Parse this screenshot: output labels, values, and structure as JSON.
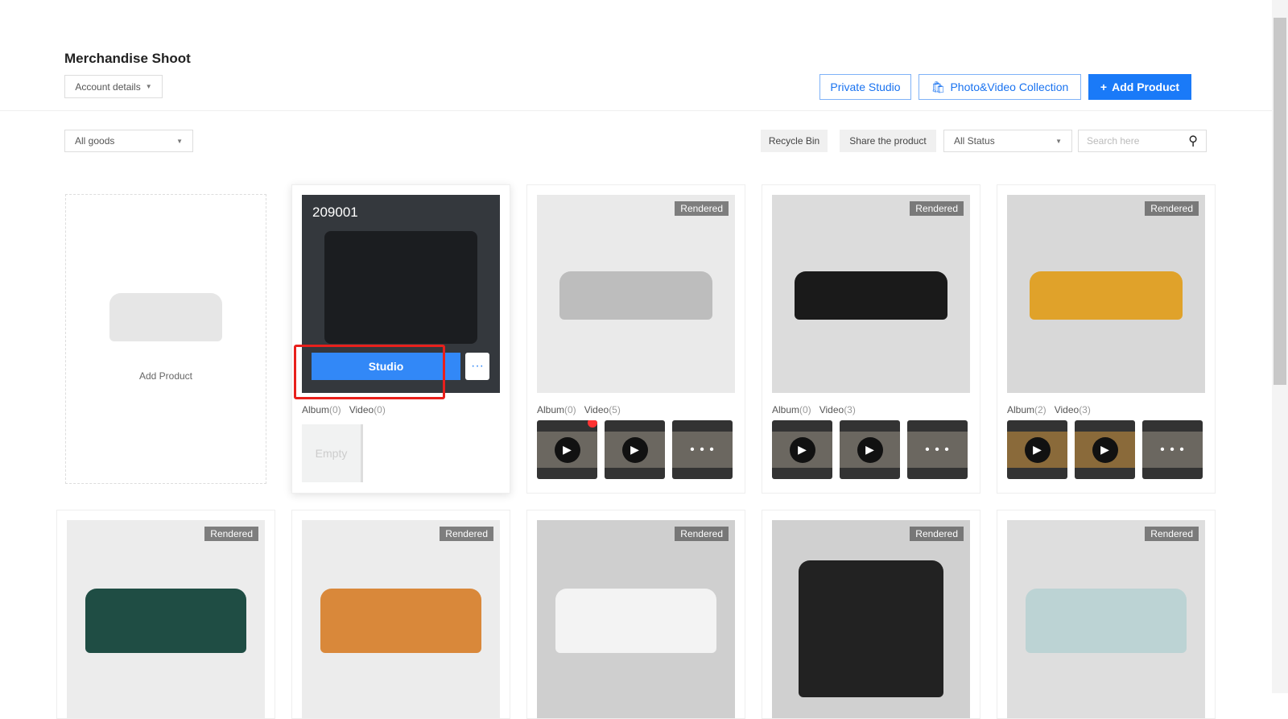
{
  "header": {
    "title": "Merchandise Shoot",
    "account": "Account details",
    "private_studio": "Private Studio",
    "collection": "Photo&Video Collection",
    "add_product": "Add Product"
  },
  "toolbar": {
    "filter": "All goods",
    "recycle": "Recycle Bin",
    "share": "Share the product",
    "status": "All Status",
    "search_placeholder": "Search here"
  },
  "add_card": {
    "label": "Add Product"
  },
  "active_card": {
    "code": "209001",
    "studio": "Studio",
    "more": "···",
    "album": "Album",
    "album_n": "(0)",
    "video": "Video",
    "video_n": "(0)",
    "empty": "Empty"
  },
  "badge": "Rendered",
  "cards": [
    {
      "album_n": "(0)",
      "video_n": "(5)",
      "color": "#bdbdbd",
      "bg": "#eaeaea"
    },
    {
      "album_n": "(0)",
      "video_n": "(3)",
      "color": "#1a1a1a",
      "bg": "#dcdcdc"
    },
    {
      "album_n": "(2)",
      "video_n": "(3)",
      "color": "#e0a22a",
      "bg": "#d8d8d8"
    }
  ],
  "row2": [
    {
      "color": "#1f4d44",
      "bg": "#ececec"
    },
    {
      "color": "#d9883a",
      "bg": "#ececec"
    },
    {
      "color": "#f3f3f3",
      "bg": "#cfcfcf"
    },
    {
      "color": "#222",
      "bg": "#d0d0d0"
    },
    {
      "color": "#bcd3d4",
      "bg": "#dedede"
    }
  ]
}
